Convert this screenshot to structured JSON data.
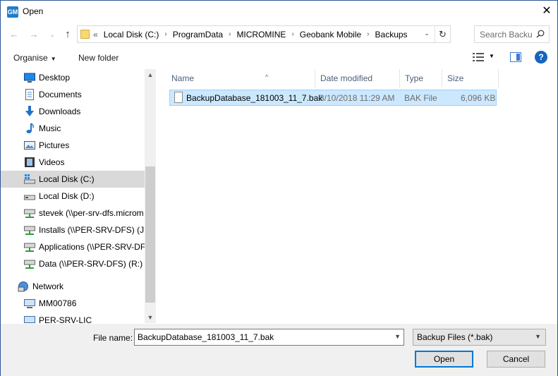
{
  "window": {
    "title": "Open",
    "app_icon_text": "GM",
    "close_glyph": "✕"
  },
  "address_bar": {
    "overflow_glyph": "«",
    "breadcrumbs": [
      "Local Disk (C:)",
      "ProgramData",
      "MICROMINE",
      "Geobank Mobile",
      "Backups"
    ],
    "separator": "›"
  },
  "search": {
    "placeholder": "Search Backups"
  },
  "toolbar": {
    "organise_label": "Organise",
    "new_folder_label": "New folder",
    "help_glyph": "?"
  },
  "nav_pane": {
    "items": [
      {
        "label": "Desktop",
        "icon": "desktop-icon"
      },
      {
        "label": "Documents",
        "icon": "documents-icon"
      },
      {
        "label": "Downloads",
        "icon": "downloads-icon"
      },
      {
        "label": "Music",
        "icon": "music-icon"
      },
      {
        "label": "Pictures",
        "icon": "pictures-icon"
      },
      {
        "label": "Videos",
        "icon": "videos-icon"
      },
      {
        "label": "Local Disk (C:)",
        "icon": "drive-icon",
        "selected": true
      },
      {
        "label": "Local Disk (D:)",
        "icon": "drive-icon"
      },
      {
        "label": "stevek (\\\\per-srv-dfs.microm",
        "icon": "network-drive-icon"
      },
      {
        "label": "Installs (\\\\PER-SRV-DFS) (J:)",
        "icon": "network-drive-icon"
      },
      {
        "label": "Applications (\\\\PER-SRV-DFS",
        "icon": "network-drive-icon"
      },
      {
        "label": "Data (\\\\PER-SRV-DFS) (R:)",
        "icon": "network-drive-icon"
      },
      {
        "label": "Network",
        "icon": "network-icon"
      },
      {
        "label": "MM00786",
        "icon": "computer-icon"
      },
      {
        "label": "PER-SRV-LIC",
        "icon": "computer-icon"
      }
    ]
  },
  "file_list": {
    "columns": [
      "Name",
      "Date modified",
      "Type",
      "Size"
    ],
    "sort_glyph": "^",
    "rows": [
      {
        "name": "BackupDatabase_181003_11_7.bak",
        "date": "3/10/2018 11:29 AM",
        "type": "BAK File",
        "size": "6,096 KB"
      }
    ]
  },
  "footer": {
    "file_name_label": "File name:",
    "file_name_value": "BackupDatabase_181003_11_7.bak",
    "file_type_value": "Backup Files (*.bak)",
    "open_label": "Open",
    "cancel_label": "Cancel"
  }
}
